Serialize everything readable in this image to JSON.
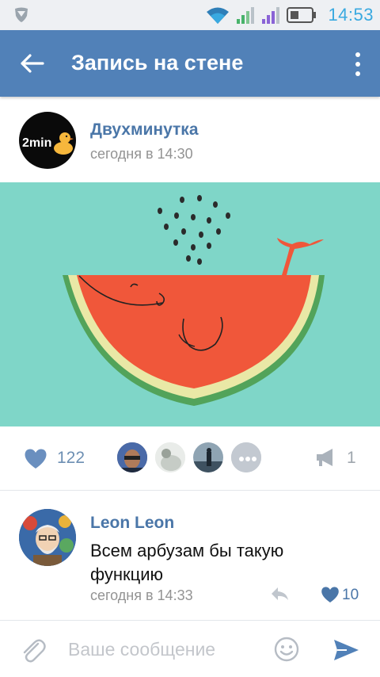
{
  "status_bar": {
    "time": "14:53",
    "icons": [
      "shield-icon",
      "wifi-icon",
      "signal-1-icon",
      "signal-2-icon",
      "battery-icon"
    ]
  },
  "header": {
    "title": "Запись на стене",
    "back_icon": "arrow-left-icon",
    "menu_icon": "more-vertical-icon",
    "color": "#5181b8"
  },
  "post": {
    "author": "Двухминутка",
    "avatar_text": "2min",
    "time": "сегодня в 14:30",
    "image_description_icon": "watermelon-whale-image"
  },
  "actions": {
    "likes": "122",
    "shares": "1",
    "like_icon": "heart-icon",
    "share_icon": "megaphone-icon",
    "likers_more_icon": "ellipsis-icon"
  },
  "comment": {
    "author": "Leon Leon",
    "text": "Всем арбузам бы такую функцию",
    "time": "сегодня в 14:33",
    "likes": "10",
    "reply_icon": "reply-icon",
    "like_icon": "heart-icon"
  },
  "composer": {
    "placeholder": "Ваше сообщение",
    "value": "",
    "attach_icon": "paperclip-icon",
    "emoji_icon": "smile-icon",
    "send_icon": "send-icon"
  },
  "colors": {
    "accent": "#5181b8",
    "link": "#4a76a8",
    "image_bg": "#7fd6c8",
    "watermelon": "#f0573a"
  }
}
